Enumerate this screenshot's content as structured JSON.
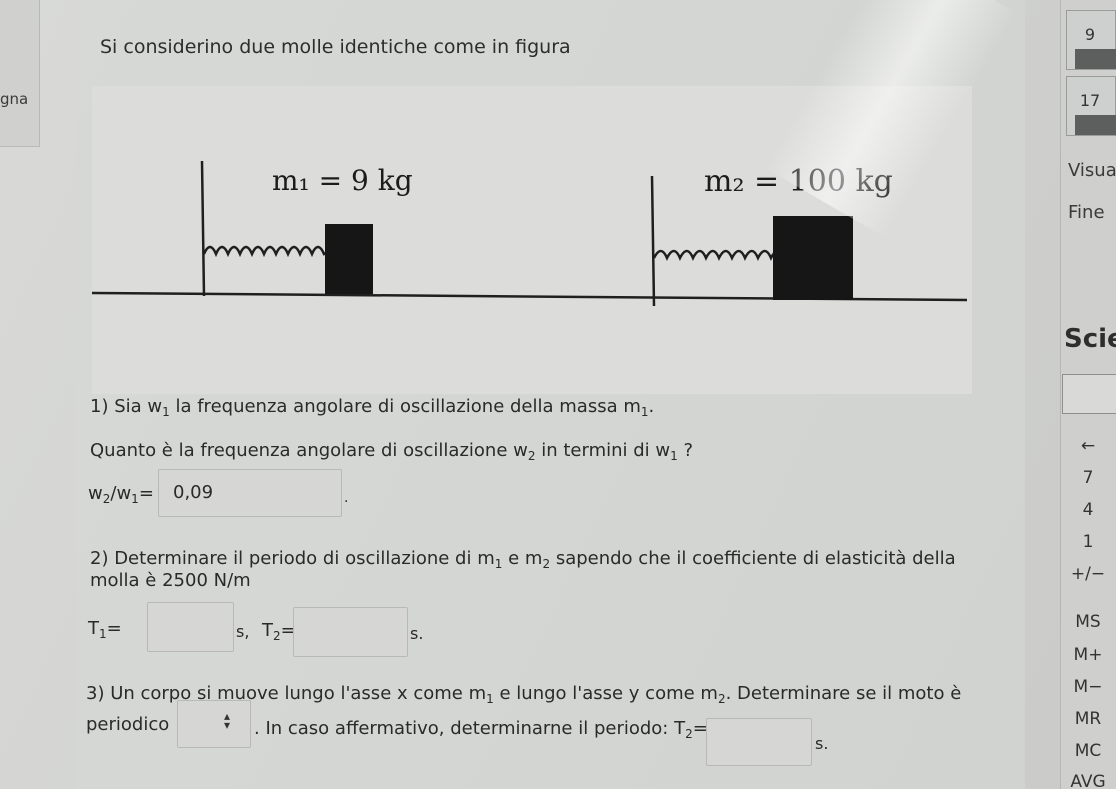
{
  "left_panel": {
    "partial_label": "gna"
  },
  "question": {
    "intro": "Si considerino due molle identiche come in figura",
    "figure": {
      "mass1_label": "m₁ = 9 kg",
      "mass2_label": "m₂ = 100 kg"
    },
    "part1": {
      "line1_a": "1) Sia w",
      "line1_sub": "1",
      "line1_b": " la frequenza angolare di oscillazione della massa m",
      "line1_sub2": "1",
      "line1_c": ".",
      "line2_a": "Quanto è la frequenza angolare di oscillazione w",
      "line2_sub": "2",
      "line2_b": " in termini di w",
      "line2_sub2": "1",
      "line2_c": " ?",
      "ratio_w": "w",
      "ratio_sub2": "2",
      "ratio_slash": "/w",
      "ratio_sub1": "1",
      "ratio_eq": "=",
      "answer_value": "0,09",
      "trailing_dot": "."
    },
    "part2": {
      "line1_a": "2) Determinare il periodo di oscillazione di m",
      "line1_sub1": "1",
      "line1_b": " e m",
      "line1_sub2": "2",
      "line1_c": " sapendo che il coefficiente di elasticità della",
      "line2": "molla è 2500 N/m",
      "t1_label": "T",
      "t1_sub": "1",
      "t1_eq": "=",
      "t1_value": "",
      "t1_unit": "s,",
      "t2_label": "T",
      "t2_sub": "2",
      "t2_eq": "=",
      "t2_value": "",
      "t2_unit": "s."
    },
    "part3": {
      "line1_a": "3) Un corpo si muove lungo l'asse x come m",
      "line1_sub1": "1",
      "line1_b": " e lungo l'asse y come m",
      "line1_sub2": "2",
      "line1_c": ". Determinare se il moto è",
      "periodic_label": "periodico",
      "select_value": "",
      "line2_b": ". In caso affermativo, determinarne il periodo: T",
      "line2_sub": "2",
      "line2_eq": "=",
      "t_value": "",
      "t_unit": "s."
    }
  },
  "side_panel": {
    "tile_top": "9",
    "tile_2": "17",
    "visua": "Visua",
    "fine": "Fine",
    "calc_title": "Scie",
    "keys": [
      "←",
      "7",
      "4",
      "1",
      "+/−",
      "MS",
      "M+",
      "M−",
      "MR",
      "MC",
      "AVG"
    ]
  }
}
